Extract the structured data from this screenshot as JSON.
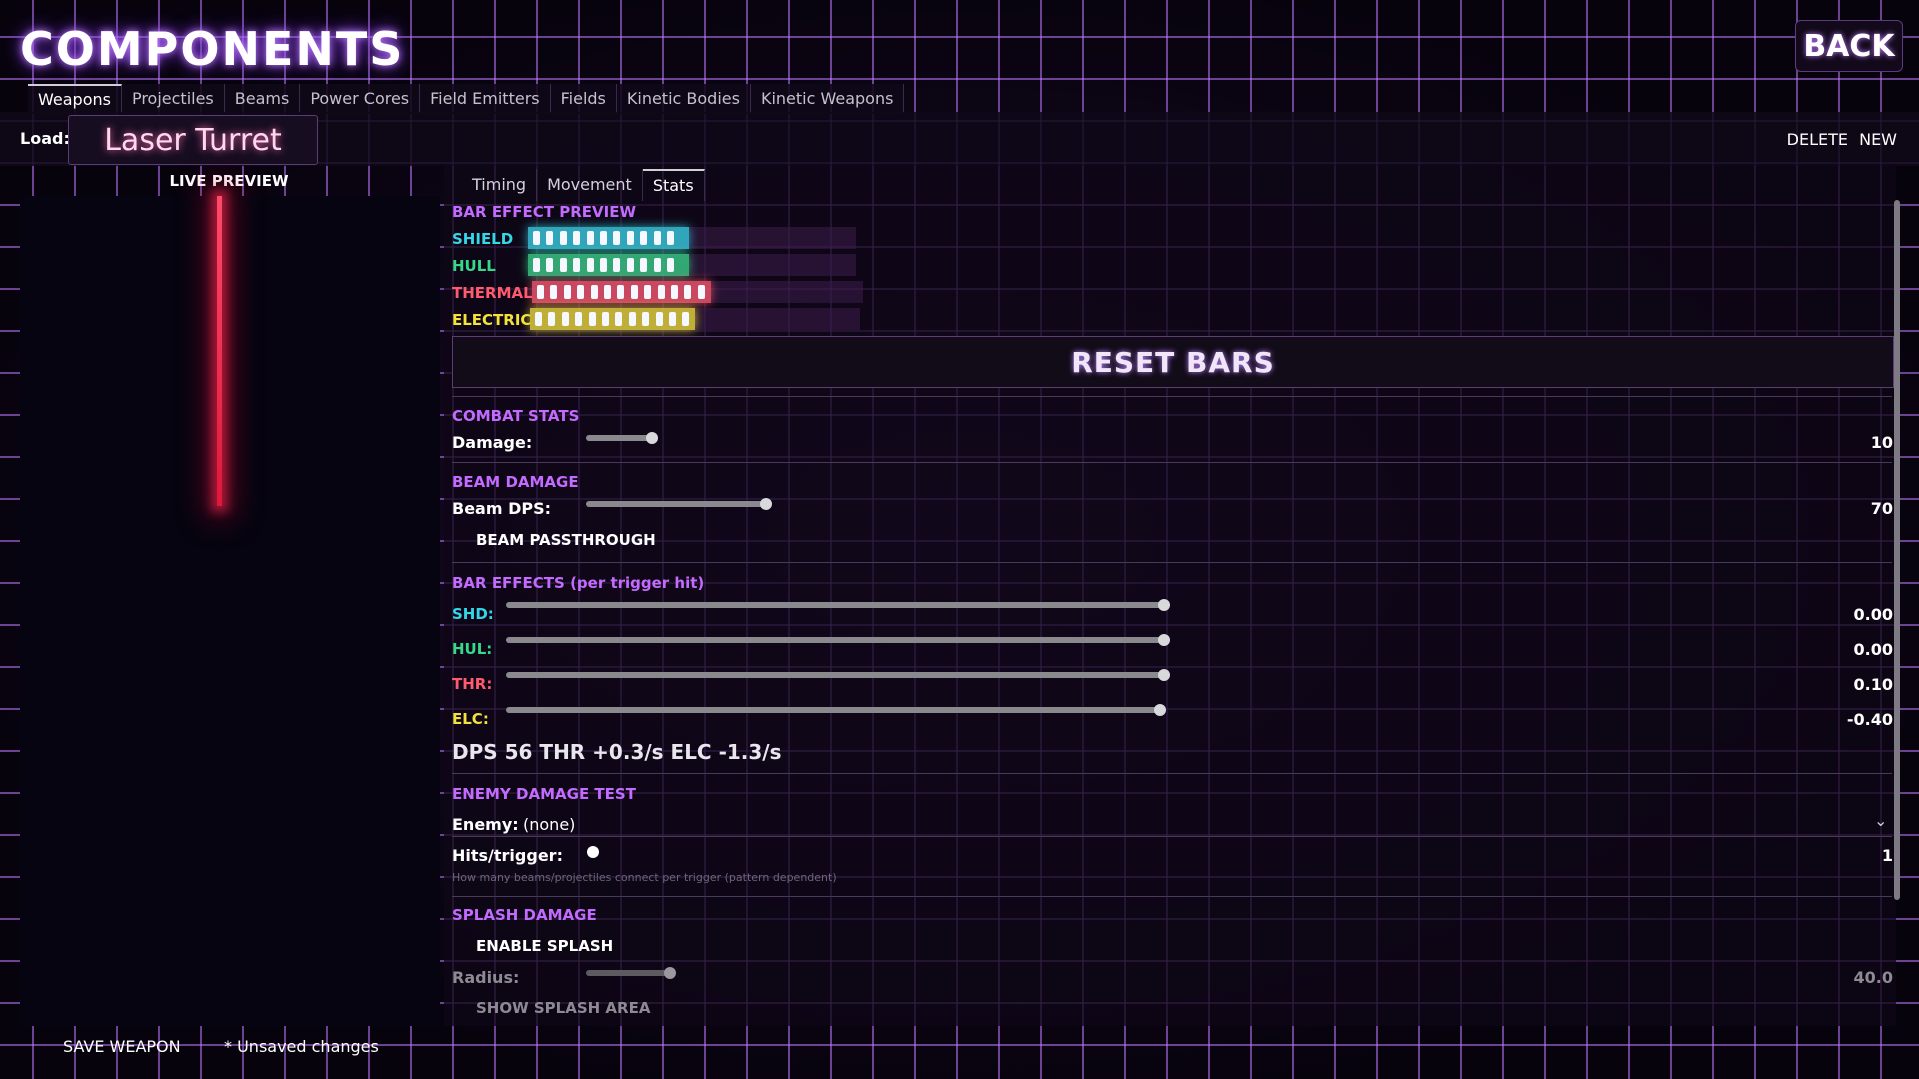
{
  "header": {
    "title": "COMPONENTS",
    "back_label": "BACK"
  },
  "tabs": [
    {
      "label": "Weapons",
      "active": true
    },
    {
      "label": "Projectiles"
    },
    {
      "label": "Beams"
    },
    {
      "label": "Power Cores"
    },
    {
      "label": "Field Emitters"
    },
    {
      "label": "Fields"
    },
    {
      "label": "Kinetic Bodies"
    },
    {
      "label": "Kinetic Weapons"
    }
  ],
  "load": {
    "label": "Load:",
    "value": "Laser Turret"
  },
  "actions": {
    "delete": "DELETE",
    "new": "NEW"
  },
  "preview": {
    "label": "LIVE PREVIEW"
  },
  "subtabs": [
    {
      "label": "Timing"
    },
    {
      "label": "Movement"
    },
    {
      "label": "Stats",
      "active": true
    }
  ],
  "bar_preview": {
    "title": "BAR EFFECT PREVIEW",
    "bars": [
      {
        "label": "SHIELD",
        "color": "#35d6e8",
        "fill": 0.49
      },
      {
        "label": "HULL",
        "color": "#36d98a",
        "fill": 0.49
      },
      {
        "label": "THERMAL",
        "color": "#ff5a6e",
        "fill": 0.54
      },
      {
        "label": "ELECTRIC",
        "color": "#f2e23a",
        "fill": 0.5
      }
    ],
    "reset_label": "RESET BARS"
  },
  "combat": {
    "title": "COMBAT STATS",
    "damage_label": "Damage:",
    "damage_value": "10",
    "damage_level": 0.25
  },
  "beam": {
    "title": "BEAM DAMAGE",
    "dps_label": "Beam DPS:",
    "dps_value": "70",
    "dps_level": 0.35,
    "passthrough_label": "BEAM PASSTHROUGH"
  },
  "bar_effects": {
    "title": "BAR EFFECTS (per trigger hit)",
    "items": [
      {
        "label": "SHD:",
        "color": "#35d6e8",
        "value": "0.00"
      },
      {
        "label": "HUL:",
        "color": "#36d98a",
        "value": "0.00"
      },
      {
        "label": "THR:",
        "color": "#ff5a6e",
        "value": "0.10"
      },
      {
        "label": "ELC:",
        "color": "#f2e23a",
        "value": "-0.40"
      }
    ]
  },
  "summary": "DPS 56  THR +0.3/s  ELC -1.3/s",
  "enemy_test": {
    "title": "ENEMY DAMAGE TEST",
    "enemy_label": "Enemy:",
    "enemy_value": "(none)",
    "hits_label": "Hits/trigger:",
    "hits_value": "1",
    "hint": "How many beams/projectiles connect per trigger (pattern dependent)"
  },
  "splash": {
    "title": "SPLASH DAMAGE",
    "enable_label": "ENABLE SPLASH",
    "radius_label": "Radius:",
    "radius_value": "40.0",
    "show_area_label": "SHOW SPLASH AREA"
  },
  "footer": {
    "save_label": "SAVE WEAPON",
    "unsaved_label": "* Unsaved changes"
  }
}
